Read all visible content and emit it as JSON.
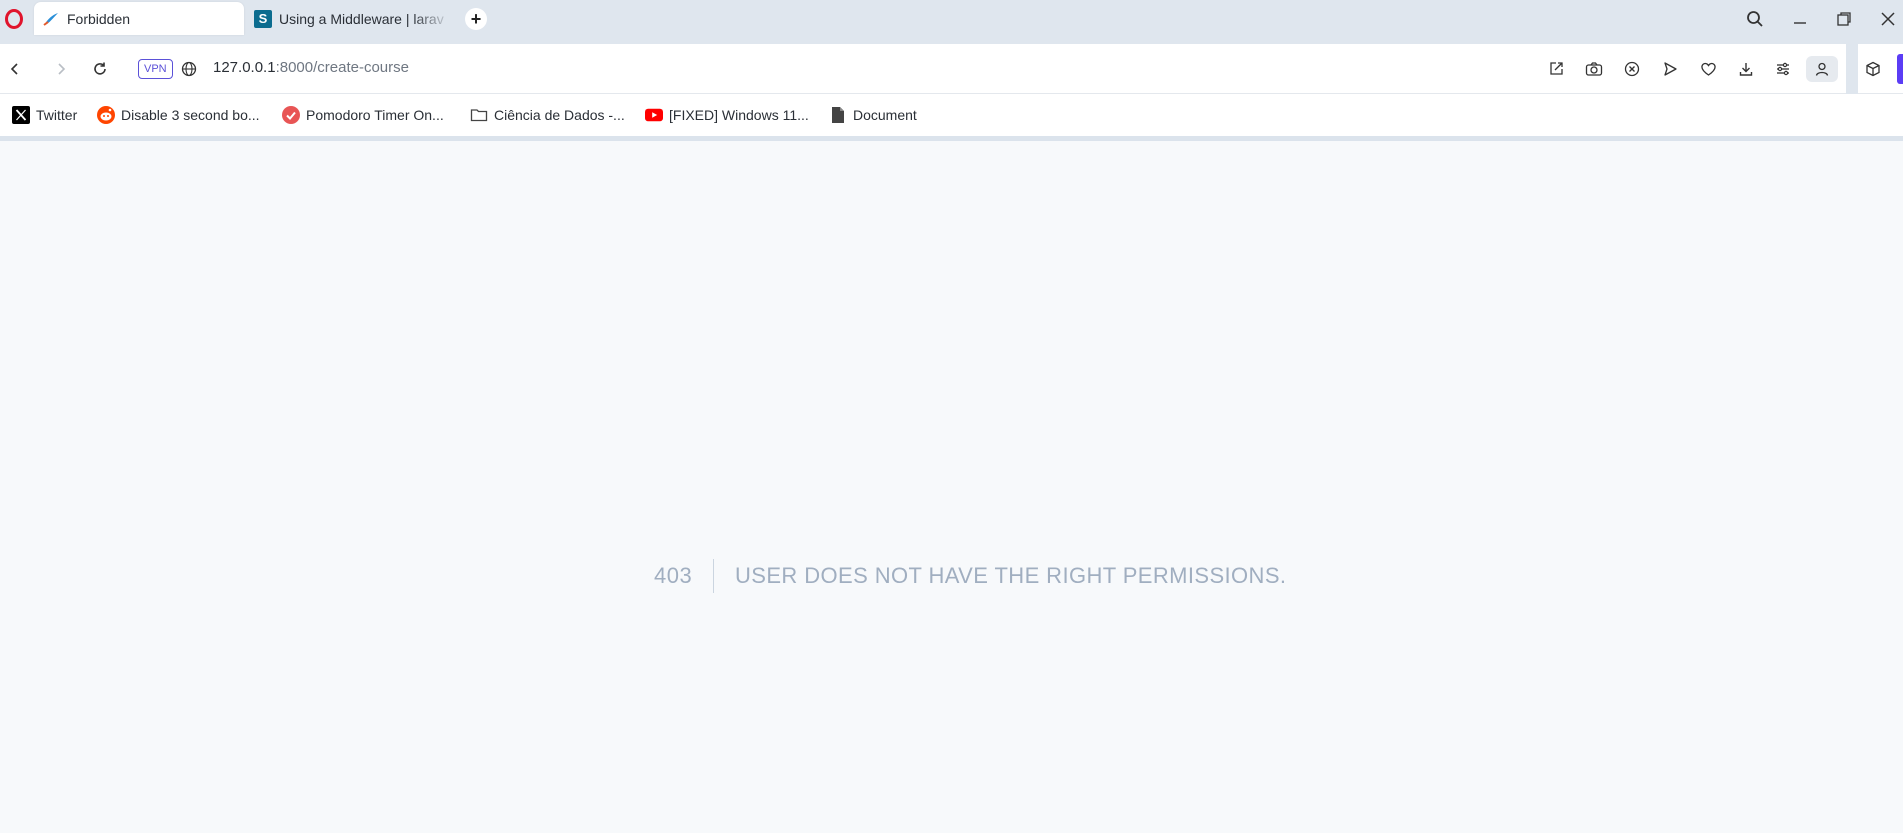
{
  "browser": {
    "tabs": [
      {
        "title": "Forbidden",
        "active": true,
        "icon": "laravel-feather-icon"
      },
      {
        "title": "Using a Middleware | larav",
        "active": false,
        "icon": "s-site-icon",
        "icon_letter": "S"
      }
    ],
    "new_tab_label": "+"
  },
  "toolbar": {
    "vpn_label": "VPN",
    "url_host": "127.0.0.1",
    "url_rest": ":8000/create-course"
  },
  "bookmarks": [
    {
      "label": "Twitter",
      "icon": "x-logo-icon"
    },
    {
      "label": "Disable 3 second bo...",
      "icon": "reddit-icon"
    },
    {
      "label": "Pomodoro Timer On...",
      "icon": "check-circle-icon"
    },
    {
      "label": "Ciência de Dados -...",
      "icon": "folder-icon"
    },
    {
      "label": "[FIXED] Windows 11...",
      "icon": "youtube-icon"
    },
    {
      "label": "Document",
      "icon": "document-icon"
    }
  ],
  "page": {
    "error_code": "403",
    "error_message": "USER DOES NOT HAVE THE RIGHT PERMISSIONS."
  },
  "colors": {
    "tabstrip": "#dfe6ee",
    "error_text": "#a0aec0",
    "vpn_accent": "#5b51d8",
    "sidebar_accent": "#5b3df5"
  }
}
